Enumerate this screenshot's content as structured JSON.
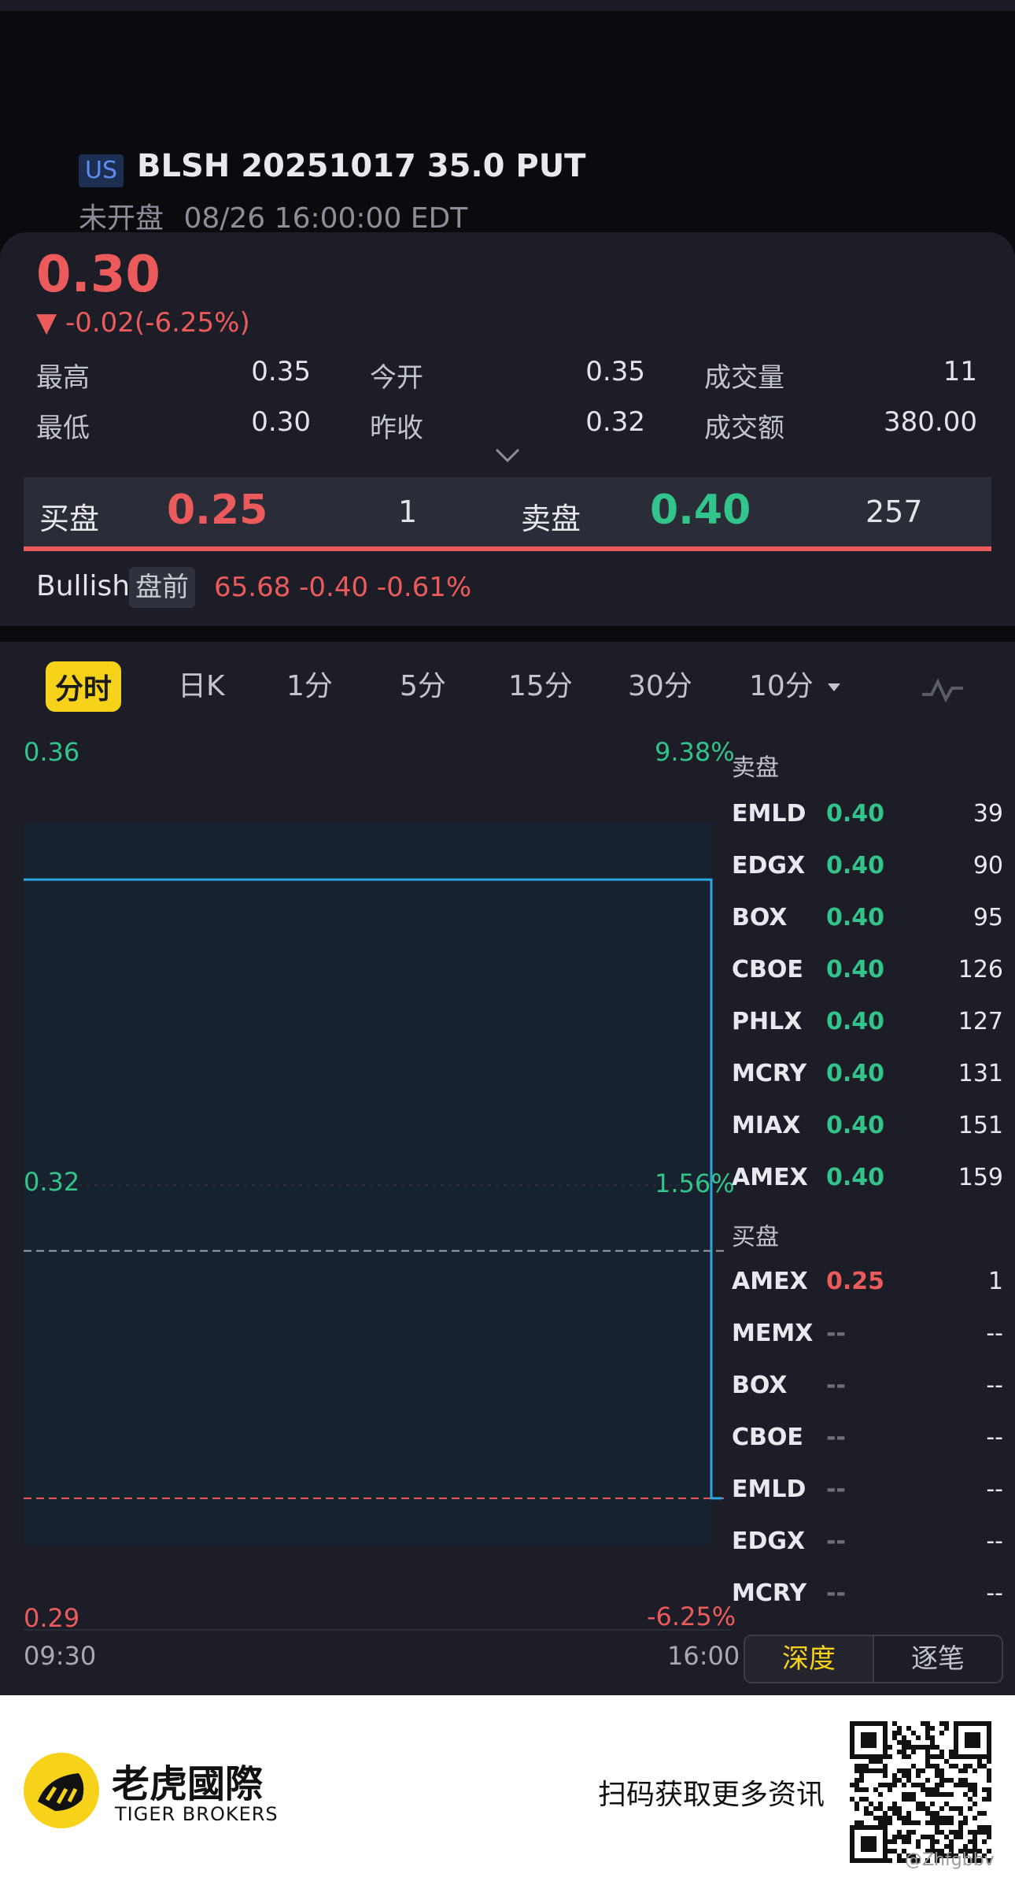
{
  "header": {
    "market_badge": "US",
    "symbol": "BLSH 20251017 35.0 PUT",
    "market_status": "未开盘",
    "timestamp": "08/26 16:00:00 EDT"
  },
  "quote": {
    "last_price": "0.30",
    "change": "▼ -0.02(-6.25%)",
    "stats": [
      {
        "label": "最高",
        "value": "0.35"
      },
      {
        "label": "今开",
        "value": "0.35"
      },
      {
        "label": "成交量",
        "value": "11"
      },
      {
        "label": "最低",
        "value": "0.30"
      },
      {
        "label": "昨收",
        "value": "0.32"
      },
      {
        "label": "成交额",
        "value": "380.00"
      }
    ]
  },
  "bid_ask": {
    "bid_label": "买盘",
    "bid_price": "0.25",
    "bid_size": "1",
    "ask_label": "卖盘",
    "ask_price": "0.40",
    "ask_size": "257"
  },
  "underlying": {
    "name": "Bullish",
    "session_tag": "盘前",
    "quote": "65.68 -0.40 -0.61%"
  },
  "tabs": [
    {
      "label": "分时",
      "active": true
    },
    {
      "label": "日K"
    },
    {
      "label": "1分"
    },
    {
      "label": "5分"
    },
    {
      "label": "15分"
    },
    {
      "label": "30分"
    },
    {
      "label": "10分"
    }
  ],
  "chart": {
    "y_top_price": "0.36",
    "y_top_pct": "9.38%",
    "y_mid_price": "0.32",
    "y_mid_pct": "1.56%",
    "y_bot_price": "0.29",
    "y_bot_pct": "-6.25%",
    "x_start": "09:30",
    "x_end": "16:00",
    "colors": {
      "line": "#2aa7e0",
      "fill": "#17222f",
      "prev_close": "#9aa0aa",
      "low": "#ec5b5b"
    }
  },
  "chart_data": {
    "type": "line",
    "x": [
      "09:30",
      "16:00"
    ],
    "series": [
      {
        "values": [
          0.35,
          0.35,
          0.3
        ]
      }
    ],
    "reference_lines": [
      0.32,
      0.3
    ],
    "ylim": [
      0.29,
      0.36
    ],
    "xlabel": "",
    "ylabel": ""
  },
  "order_book": {
    "ask_header": "卖盘",
    "asks": [
      {
        "exchange": "EMLD",
        "price": "0.40",
        "size": "39"
      },
      {
        "exchange": "EDGX",
        "price": "0.40",
        "size": "90"
      },
      {
        "exchange": "BOX",
        "price": "0.40",
        "size": "95"
      },
      {
        "exchange": "CBOE",
        "price": "0.40",
        "size": "126"
      },
      {
        "exchange": "PHLX",
        "price": "0.40",
        "size": "127"
      },
      {
        "exchange": "MCRY",
        "price": "0.40",
        "size": "131"
      },
      {
        "exchange": "MIAX",
        "price": "0.40",
        "size": "151"
      },
      {
        "exchange": "AMEX",
        "price": "0.40",
        "size": "159"
      }
    ],
    "bid_header": "买盘",
    "bids": [
      {
        "exchange": "AMEX",
        "price": "0.25",
        "size": "1"
      },
      {
        "exchange": "MEMX",
        "price": "--",
        "size": "--"
      },
      {
        "exchange": "BOX",
        "price": "--",
        "size": "--"
      },
      {
        "exchange": "CBOE",
        "price": "--",
        "size": "--"
      },
      {
        "exchange": "EMLD",
        "price": "--",
        "size": "--"
      },
      {
        "exchange": "EDGX",
        "price": "--",
        "size": "--"
      },
      {
        "exchange": "MCRY",
        "price": "--",
        "size": "--"
      }
    ],
    "depth_label": "深度",
    "ticks_label": "逐笔"
  },
  "footer": {
    "brand_cn": "老虎國際",
    "brand_en": "TIGER BROKERS",
    "scan_text": "扫码获取更多资讯",
    "watermark": "@Zhfgbbv"
  }
}
